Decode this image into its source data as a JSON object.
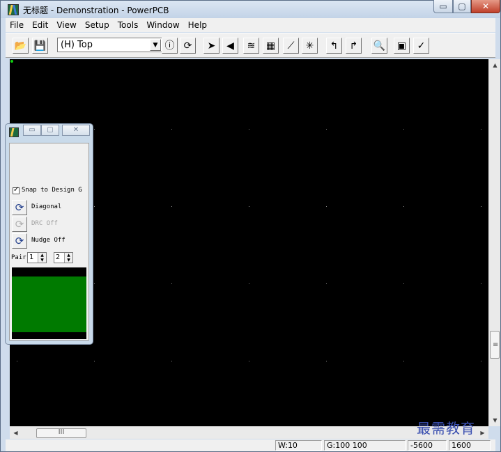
{
  "window": {
    "title": "无标题 - Demonstration - PowerPCB",
    "controls": {
      "minimize": "▭",
      "maximize": "▢",
      "close": "✕"
    }
  },
  "menu": [
    "File",
    "Edit",
    "View",
    "Setup",
    "Tools",
    "Window",
    "Help"
  ],
  "toolbar": {
    "layer_select": {
      "value": "(H) Top"
    },
    "buttons": [
      {
        "name": "open-icon",
        "glyph": "📂"
      },
      {
        "name": "save-icon",
        "glyph": "💾"
      },
      {
        "name": "info-icon",
        "glyph": "ⓘ"
      },
      {
        "name": "cycle-icon",
        "glyph": "⟳"
      },
      {
        "name": "select-arrow-icon",
        "glyph": "➤"
      },
      {
        "name": "drafting-icon",
        "glyph": "◀"
      },
      {
        "name": "route-icon",
        "glyph": "≋"
      },
      {
        "name": "design-icon",
        "glyph": "▦"
      },
      {
        "name": "line-icon",
        "glyph": "⟋"
      },
      {
        "name": "star-icon",
        "glyph": "✳"
      },
      {
        "name": "undo-icon",
        "glyph": "↰"
      },
      {
        "name": "redo-icon",
        "glyph": "↱"
      },
      {
        "name": "zoom-icon",
        "glyph": "🔍"
      },
      {
        "name": "board-icon",
        "glyph": "▣"
      },
      {
        "name": "checkmark-icon",
        "glyph": "✓"
      }
    ]
  },
  "mini_window": {
    "controls": {
      "minimize": "▭",
      "maximize": "▢",
      "close": "✕"
    },
    "snap_label": "Snap to Design G",
    "snap_checked": true,
    "diagonal_label": "Diagonal",
    "drc_label": "DRC Off",
    "nudge_label": "Nudge Off",
    "pair_label": "Pair",
    "pair_value_1": "1",
    "pair_value_2": "2"
  },
  "scrollbars": {
    "up": "▲",
    "down": "▼",
    "left": "◀",
    "right": "▶",
    "grip_v": "≡",
    "grip_h": "III"
  },
  "status": {
    "width": "W:10",
    "grid": "G:100 100",
    "x": "-5600",
    "y": "1600"
  },
  "watermark": "最需教育",
  "colors": {
    "canvas": "#000000",
    "grid_dot": "#8a8a8a",
    "origin": "#12d012",
    "preview_fill": "#007a00",
    "watermark": "#3a4fb0"
  }
}
